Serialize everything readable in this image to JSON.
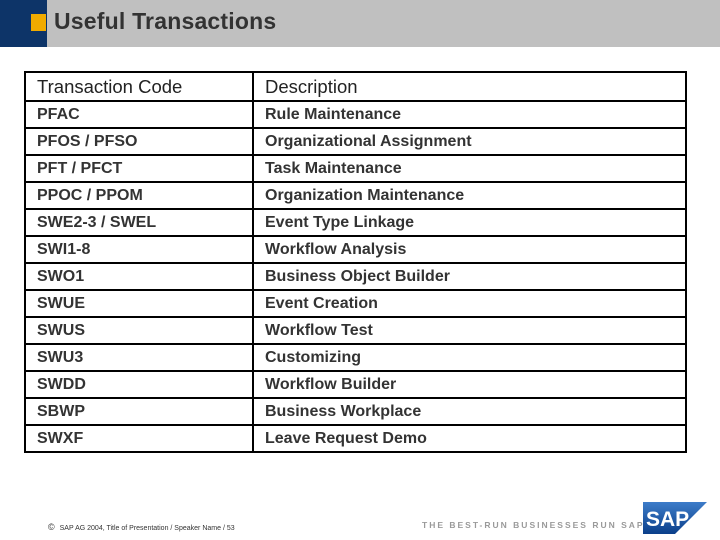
{
  "header": {
    "title": "Useful Transactions"
  },
  "table": {
    "columns": [
      "Transaction Code",
      "Description"
    ],
    "rows": [
      [
        "PFAC",
        "Rule Maintenance"
      ],
      [
        "PFOS / PFSO",
        "Organizational Assignment"
      ],
      [
        "PFT / PFCT",
        "Task Maintenance"
      ],
      [
        "PPOC / PPOM",
        "Organization Maintenance"
      ],
      [
        "SWE2-3 / SWEL",
        "Event Type Linkage"
      ],
      [
        "SWI1-8",
        "Workflow Analysis"
      ],
      [
        "SWO1",
        "Business Object Builder"
      ],
      [
        "SWUE",
        "Event Creation"
      ],
      [
        "SWUS",
        "Workflow Test"
      ],
      [
        "SWU3",
        "Customizing"
      ],
      [
        "SWDD",
        "Workflow Builder"
      ],
      [
        "SBWP",
        "Business Workplace"
      ],
      [
        "SWXF",
        "Leave Request Demo"
      ]
    ]
  },
  "footer": {
    "copyright_symbol": "©",
    "copyright_text": "SAP AG 2004, Title of Presentation / Speaker Name / 53",
    "tagline": "THE BEST-RUN BUSINESSES RUN SAP",
    "logo_text": "SAP"
  },
  "colors": {
    "navy": "#0d3468",
    "gold": "#f0ab00",
    "header_gray": "#c0c0c0",
    "sap_blue": "#1a5ba6"
  }
}
